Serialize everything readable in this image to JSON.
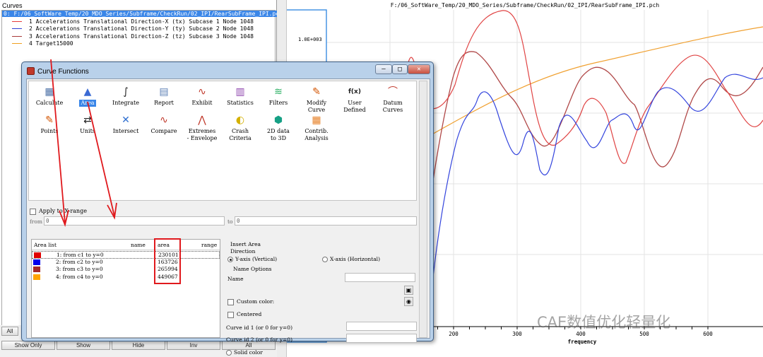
{
  "curves_panel": {
    "label": "Curves",
    "root_label": "0: F:/06_SoftWare_Temp/20_MDO_Series/Subframe/CheckRun/02_IPI/RearSubFrame_IPI.pch",
    "items": [
      {
        "label": "1 Accelerations Translational Direction-X (tx) Subcase 1 Node 1048",
        "color": "#e53b3b"
      },
      {
        "label": "2 Accelerations Translational Direction-Y (ty) Subcase 2 Node 1048",
        "color": "#2f3fd6"
      },
      {
        "label": "3 Accelerations Translational Direction-Z (tz) Subcase 3 Node 1048",
        "color": "#a83a3a"
      },
      {
        "label": "4 Target15000",
        "color": "#f0a020"
      }
    ],
    "all_button": "All",
    "buttons": [
      "Show Only",
      "Show",
      "Hide",
      "Inv",
      "All"
    ]
  },
  "plot": {
    "title": "F:/06_SoftWare_Temp/20_MDO_Series/Subframe/CheckRun/02_IPI/RearSubFrame_IPI.pch",
    "y_tick": "1.0E+003",
    "x_label": "frequency",
    "x_ticks": [
      "200",
      "300",
      "400",
      "500",
      "600"
    ]
  },
  "dialog": {
    "title": "Curve Functions",
    "tools": [
      {
        "name": "calculate",
        "label": "Calculate",
        "icon": "▦",
        "color": "#4a6fa5"
      },
      {
        "name": "area",
        "label": "Area",
        "icon": "▲",
        "color": "#3a6ad4"
      },
      {
        "name": "integrate",
        "label": "Integrate",
        "icon": "∫",
        "color": "#222222"
      },
      {
        "name": "report",
        "label": "Report",
        "icon": "▤",
        "color": "#5b7fb5"
      },
      {
        "name": "exhibit",
        "label": "Exhibit",
        "icon": "∿",
        "color": "#c0392b"
      },
      {
        "name": "statistics",
        "label": "Statistics",
        "icon": "▥",
        "color": "#8e44ad"
      },
      {
        "name": "filters",
        "label": "Filters",
        "icon": "≋",
        "color": "#27ae60"
      },
      {
        "name": "modify-curve",
        "label": "Modify\nCurve",
        "icon": "✎",
        "color": "#d35400"
      },
      {
        "name": "user-defined",
        "label": "User\nDefined",
        "icon": "f(x)",
        "color": "#222222"
      },
      {
        "name": "datum-curves",
        "label": "Datum\nCurves",
        "icon": "⌒",
        "color": "#c0392b"
      },
      {
        "name": "points",
        "label": "Points",
        "icon": "✎",
        "color": "#d35400"
      },
      {
        "name": "units",
        "label": "Units",
        "icon": "⇄",
        "color": "#222222"
      },
      {
        "name": "intersect",
        "label": "Intersect",
        "icon": "✕",
        "color": "#2f6fd0"
      },
      {
        "name": "compare",
        "label": "Compare",
        "icon": "∿",
        "color": "#c0392b"
      },
      {
        "name": "extremes-envelope",
        "label": "Extremes\n- Envelope",
        "icon": "⋀",
        "color": "#c0392b"
      },
      {
        "name": "crash-criteria",
        "label": "Crash\nCriteria",
        "icon": "◐",
        "color": "#d4b000"
      },
      {
        "name": "2d-data-to-3d",
        "label": "2D data\nto 3D",
        "icon": "⬢",
        "color": "#16a085"
      },
      {
        "name": "contrib-analysis",
        "label": "Contrib.\nAnalysis",
        "icon": "▦",
        "color": "#e67e22"
      }
    ],
    "apply_label": "Apply to X-range",
    "from_label": "from",
    "from_value": "0",
    "to_label": "to",
    "to_value": "0",
    "area_list": {
      "headers": {
        "list": "Area list",
        "name": "name",
        "area": "area",
        "range": "range"
      },
      "rows": [
        {
          "text": "1: from c1 to y=0",
          "area": "230101",
          "color": "#e00000"
        },
        {
          "text": "2: from c2 to y=0",
          "area": "163726",
          "color": "#0000ee"
        },
        {
          "text": "3: from c3 to y=0",
          "area": "265994",
          "color": "#a52a2a"
        },
        {
          "text": "4: from c4 to y=0",
          "area": "449067",
          "color": "#ffa500"
        }
      ]
    },
    "options": {
      "insert_area": "Insert Area",
      "direction": "Direction",
      "y_axis": "Y-axis (Vertical)",
      "x_axis": "X-axis (Horizontal)",
      "name_options": "Name Options",
      "name_label": "Name",
      "custom_color": "Custom color:",
      "centered": "Centered",
      "curve_id1": "Curve id 1 (or 0 for y=0)",
      "curve_id2": "Curve id 2 (or 0 for y=0)",
      "solid_color": "Solid color"
    }
  },
  "watermark": "CAE数值优化轻量化"
}
